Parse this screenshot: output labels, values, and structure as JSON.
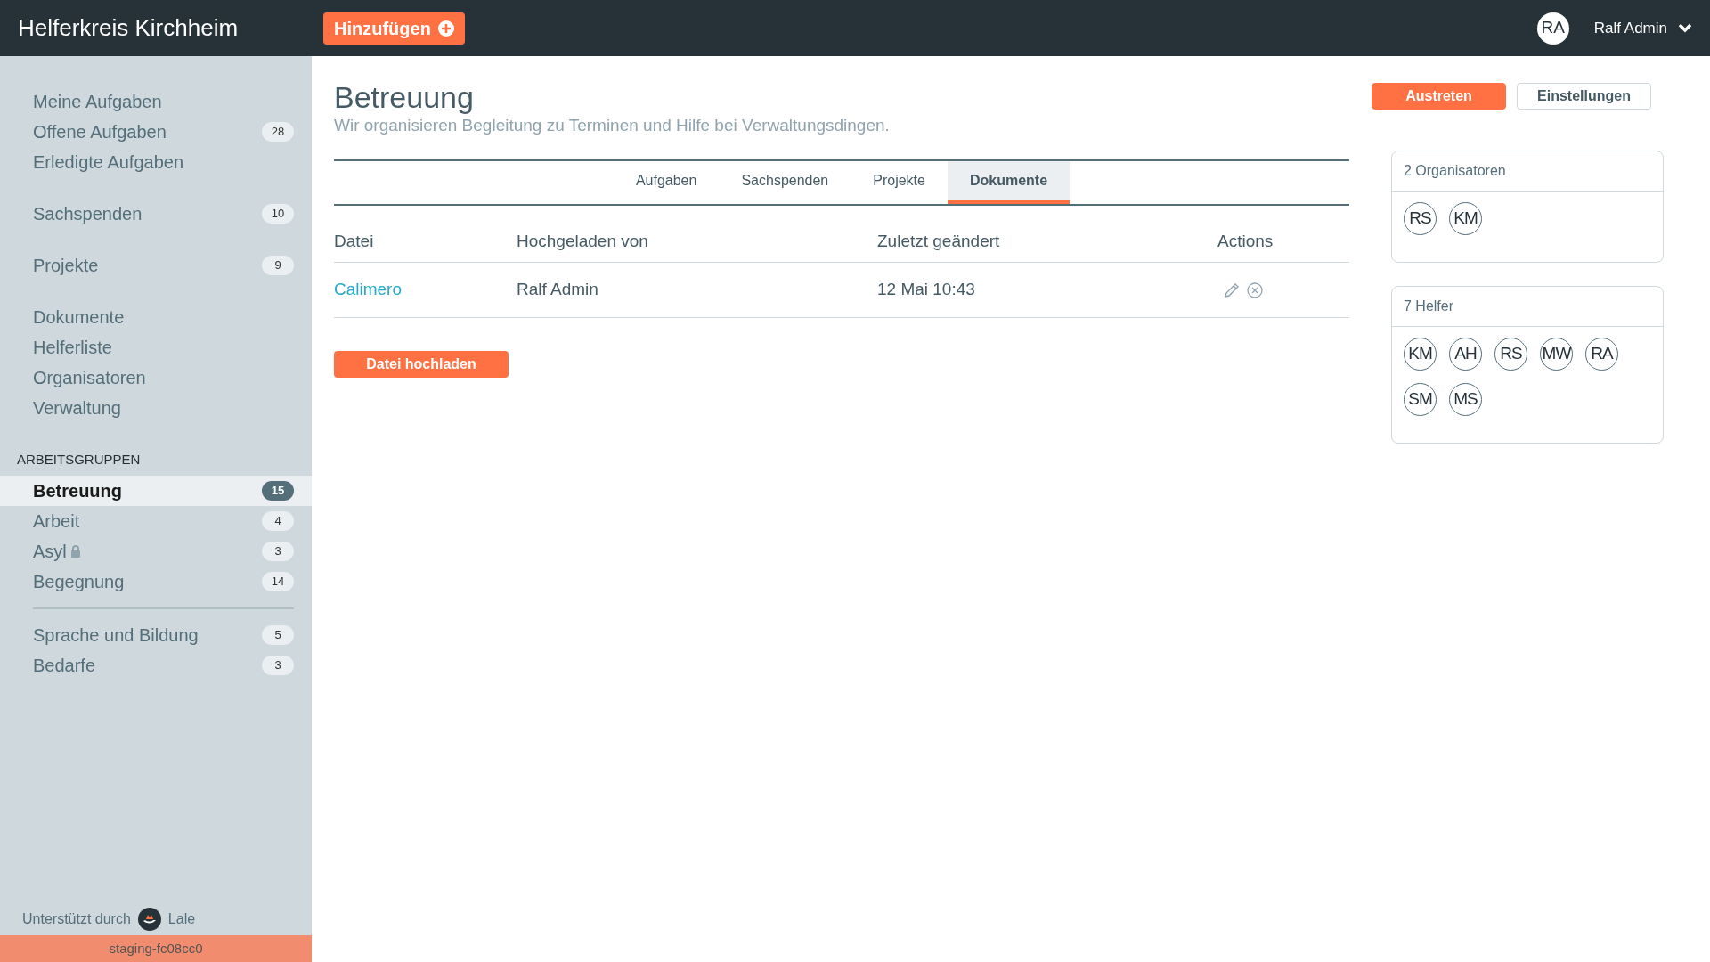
{
  "header": {
    "title": "Helferkreis Kirchheim",
    "add_button": "Hinzufügen",
    "user": {
      "initials": "RA",
      "name": "Ralf Admin"
    }
  },
  "sidebar": {
    "sections": [
      {
        "items": [
          {
            "label": "Meine Aufgaben"
          },
          {
            "label": "Offene Aufgaben",
            "badge": "28"
          },
          {
            "label": "Erledigte Aufgaben"
          }
        ]
      },
      {
        "items": [
          {
            "label": "Sachspenden",
            "badge": "10"
          }
        ]
      },
      {
        "items": [
          {
            "label": "Projekte",
            "badge": "9"
          }
        ]
      },
      {
        "items": [
          {
            "label": "Dokumente"
          },
          {
            "label": "Helferliste"
          },
          {
            "label": "Organisatoren"
          },
          {
            "label": "Verwaltung"
          }
        ]
      }
    ],
    "groups_heading": "ARBEITSGRUPPEN",
    "group_blocks": [
      {
        "items": [
          {
            "label": "Betreuung",
            "badge": "15",
            "selected": true,
            "locked": false
          },
          {
            "label": "Arbeit",
            "badge": "4",
            "selected": false,
            "locked": false
          },
          {
            "label": "Asyl",
            "badge": "3",
            "selected": false,
            "locked": true
          },
          {
            "label": "Begegnung",
            "badge": "14",
            "selected": false,
            "locked": false
          }
        ]
      },
      {
        "items": [
          {
            "label": "Sprache und Bildung",
            "badge": "5",
            "selected": false,
            "locked": false
          },
          {
            "label": "Bedarfe",
            "badge": "3",
            "selected": false,
            "locked": false
          }
        ]
      }
    ],
    "footer": {
      "prefix": "Unterstützt durch",
      "brand": "Lale"
    },
    "build": "staging-fc08cc0"
  },
  "page": {
    "title": "Betreuung",
    "description": "Wir organisieren Begleitung zu Terminen und Hilfe bei Verwaltungsdingen.",
    "buttons": [
      {
        "label": "Austreten",
        "kind": "primary"
      },
      {
        "label": "Einstellungen",
        "kind": "outline"
      }
    ]
  },
  "tabs": [
    {
      "label": "Aufgaben",
      "selected": false
    },
    {
      "label": "Sachspenden",
      "selected": false
    },
    {
      "label": "Projekte",
      "selected": false
    },
    {
      "label": "Dokumente",
      "selected": true
    }
  ],
  "table": {
    "columns": [
      "Datei",
      "Hochgeladen von",
      "Zuletzt geändert",
      "Actions"
    ],
    "rows": [
      {
        "file": "Calimero",
        "uploader": "Ralf Admin",
        "modified": "12 Mai 10:43"
      }
    ]
  },
  "upload_button": "Datei hochladen",
  "cards": [
    {
      "title": "2 Organisatoren",
      "members": [
        "RS",
        "KM"
      ]
    },
    {
      "title": "7 Helfer",
      "members": [
        "KM",
        "AH",
        "RS",
        "MW",
        "RA",
        "SM",
        "MS"
      ]
    }
  ]
}
